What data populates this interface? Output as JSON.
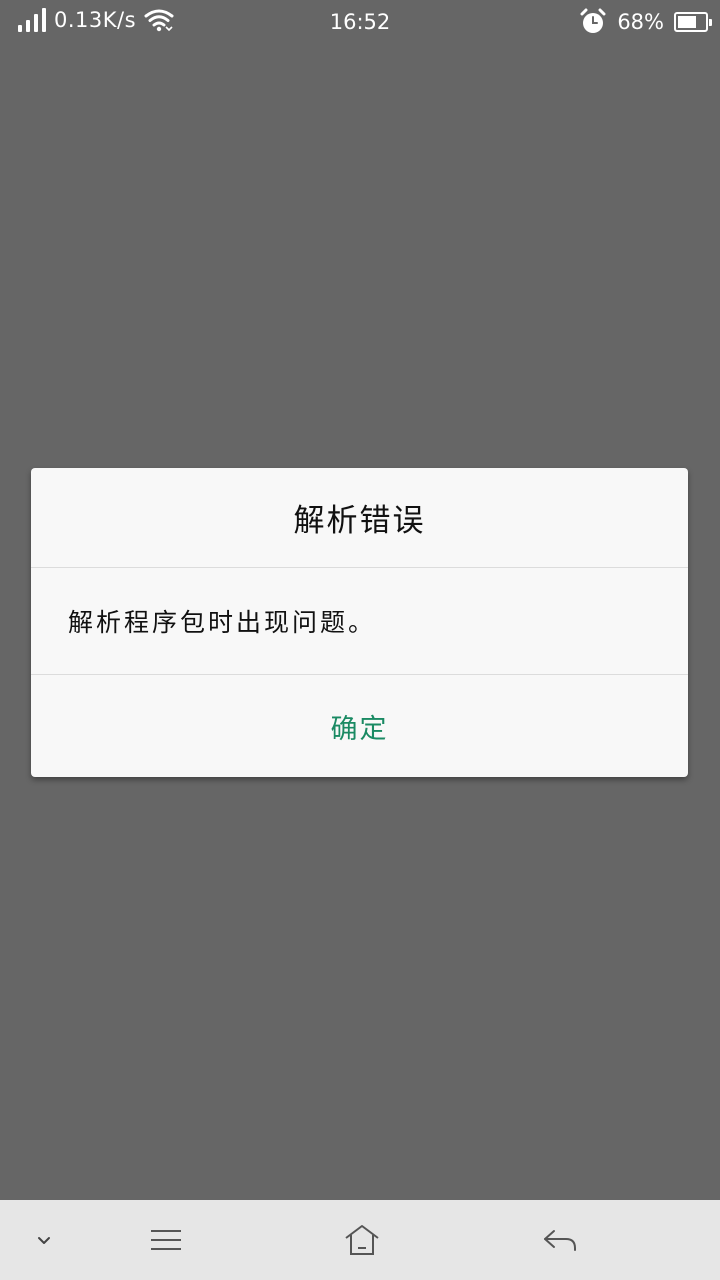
{
  "status_bar": {
    "net_speed": "0.13K/s",
    "time": "16:52",
    "battery_percent_text": "68%",
    "battery_level": 0.68,
    "icons": [
      "signal-icon",
      "wifi-icon",
      "alarm-icon",
      "battery-icon"
    ]
  },
  "dialog": {
    "title": "解析错误",
    "message": "解析程序包时出现问题。",
    "confirm_label": "确定",
    "accent_color": "#1a8a63"
  },
  "nav_bar": {
    "icons": [
      "collapse-chevron-icon",
      "menu-icon",
      "home-icon",
      "back-icon"
    ]
  },
  "colors": {
    "background": "#666666",
    "dialog_background": "#f8f8f8",
    "nav_background": "#e6e6e6"
  }
}
